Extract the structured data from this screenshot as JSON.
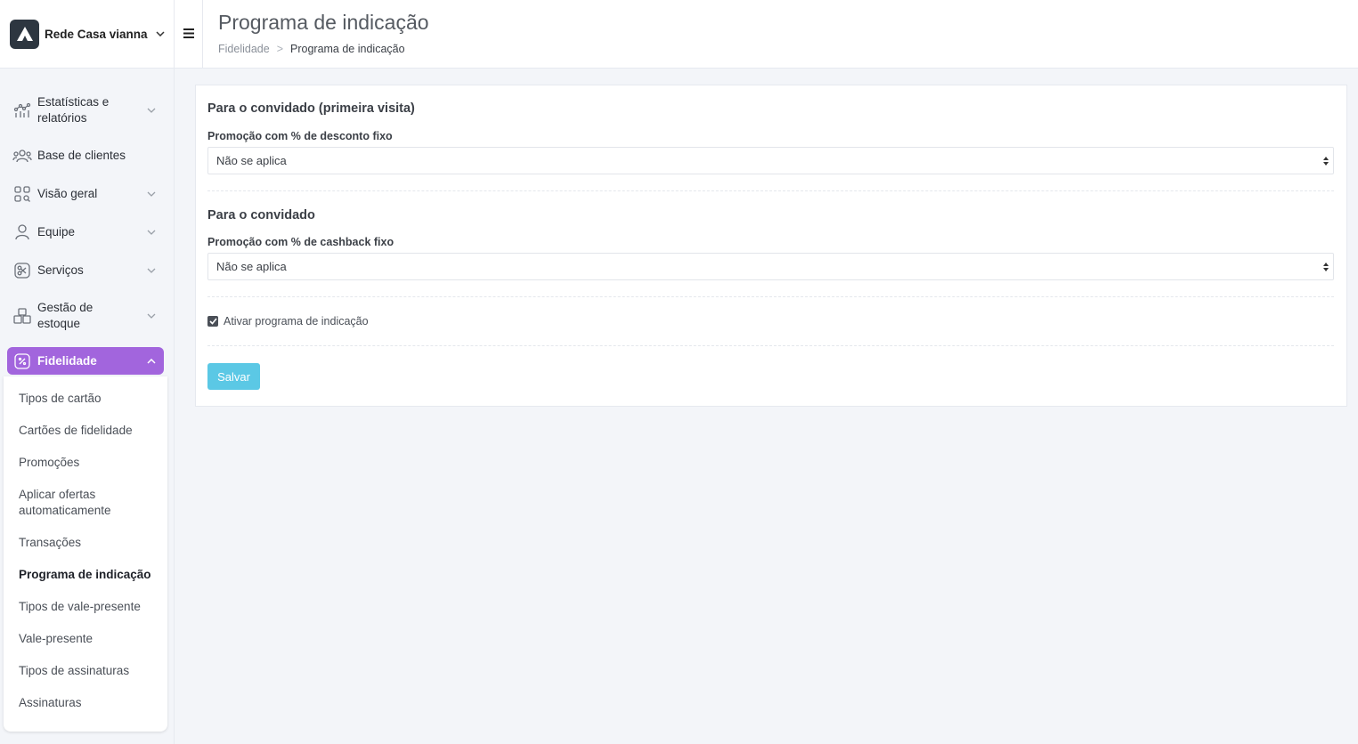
{
  "brand": {
    "name": "Rede Casa vianna"
  },
  "header": {
    "title": "Programa de indicação",
    "breadcrumb": [
      "Fidelidade",
      "Programa de indicação"
    ],
    "breadcrumb_sep": ">"
  },
  "sidebar": {
    "items": [
      {
        "label": "Estatísticas e relatórios",
        "icon": "chart-icon"
      },
      {
        "label": "Base de clientes",
        "icon": "users-icon"
      },
      {
        "label": "Visão geral",
        "icon": "grid-icon"
      },
      {
        "label": "Equipe",
        "icon": "user-icon"
      },
      {
        "label": "Serviços",
        "icon": "scissors-icon"
      },
      {
        "label": "Gestão de estoque",
        "icon": "boxes-icon"
      },
      {
        "label": "Fidelidade",
        "icon": "percent-icon"
      }
    ],
    "submenu": [
      "Tipos de cartão",
      "Cartões de fidelidade",
      "Promoções",
      "Aplicar ofertas automaticamente",
      "Transações",
      "Programa de indicação",
      "Tipos de vale-presente",
      "Vale-presente",
      "Tipos de assinaturas",
      "Assinaturas"
    ]
  },
  "form": {
    "section1_title": "Para o convidado (primeira visita)",
    "field1_label": "Promoção com % de desconto fixo",
    "field1_value": "Não se aplica",
    "section2_title": "Para o convidado",
    "field2_label": "Promoção com % de cashback fixo",
    "field2_value": "Não se aplica",
    "checkbox_label": "Ativar programa de indicação",
    "checkbox_checked": true,
    "save_label": "Salvar"
  },
  "colors": {
    "accent": "#a265dd",
    "save_button": "#5bc8e5",
    "background": "#f3f5f9"
  }
}
